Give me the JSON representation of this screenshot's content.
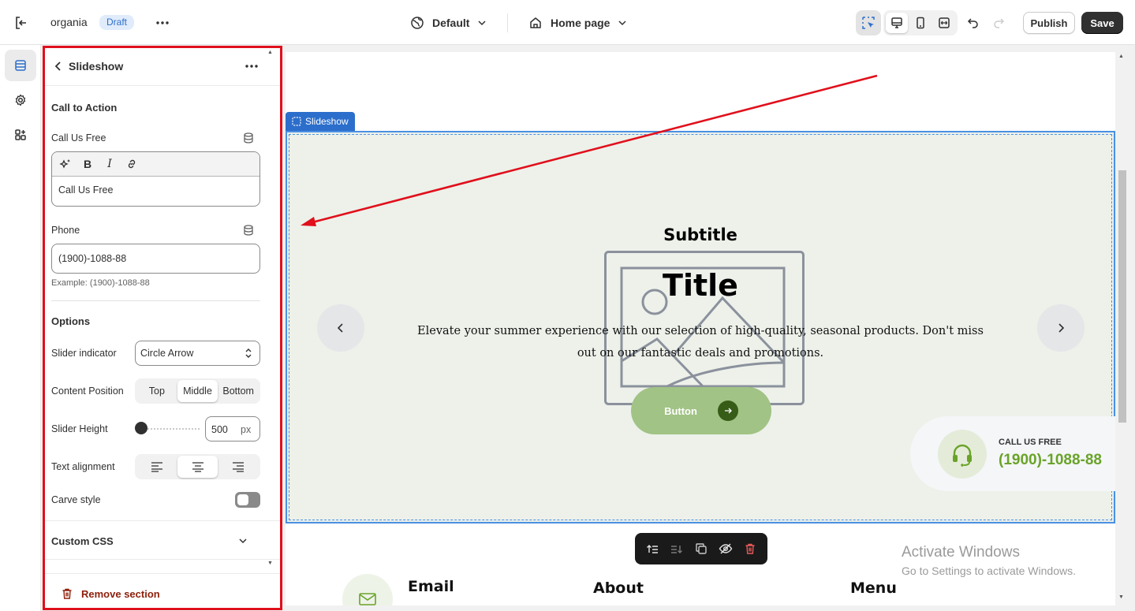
{
  "topbar": {
    "store_name": "organia",
    "status_badge": "Draft",
    "theme_label": "Default",
    "page_label": "Home page",
    "publish_label": "Publish",
    "save_label": "Save"
  },
  "panel": {
    "title": "Slideshow",
    "call_to_action_heading": "Call to Action",
    "call_label": "Call Us Free",
    "call_value": "Call Us Free",
    "phone_label": "Phone",
    "phone_value": "(1900)-1088-88",
    "phone_help": "Example: (1900)-1088-88",
    "options_heading": "Options",
    "slider_indicator_label": "Slider indicator",
    "slider_indicator_value": "Circle Arrow",
    "content_position_label": "Content Position",
    "content_position_options": [
      "Top",
      "Middle",
      "Bottom"
    ],
    "content_position_selected": "Middle",
    "slider_height_label": "Slider Height",
    "slider_height_value": "500",
    "slider_height_unit": "px",
    "text_alignment_label": "Text alignment",
    "text_alignment_selected": "center",
    "carve_style_label": "Carve style",
    "carve_style_on": false,
    "custom_css_label": "Custom CSS",
    "remove_label": "Remove section"
  },
  "preview": {
    "section_tag": "Slideshow",
    "subtitle": "Subtitle",
    "title": "Title",
    "description": "Elevate your summer experience with our selection of high-quality, seasonal products. Don't miss out on our fantastic deals and promotions.",
    "button_label": "Button",
    "call_label": "CALL US FREE",
    "call_phone": "(1900)-1088-88",
    "footer_email": "Email",
    "footer_about": "About",
    "footer_menu": "Menu"
  },
  "watermark": {
    "title": "Activate Windows",
    "subtitle": "Go to Settings to activate Windows."
  },
  "colors": {
    "accent": "#2c6ecb",
    "annotation_red": "#e0101c",
    "brand_green": "#6aa329",
    "button_green": "#a1c385",
    "slide_bg": "#edf1ea"
  },
  "icons": {
    "exit": "exit-icon",
    "theme": "globe-icon",
    "page": "home-icon",
    "inspector": "inspector-icon",
    "desktop": "desktop-icon",
    "mobile": "mobile-icon",
    "fullscreen": "fullscreen-icon",
    "undo": "undo-icon",
    "redo": "redo-icon",
    "remove": "trash-icon",
    "call": "headset-icon"
  }
}
